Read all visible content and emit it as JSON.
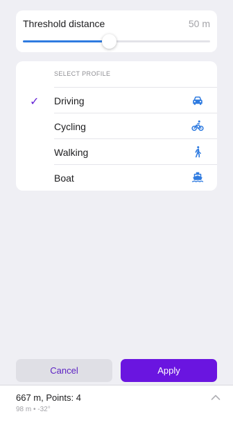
{
  "threshold": {
    "label": "Threshold distance",
    "value_text": "50 m",
    "slider_fraction": 0.46
  },
  "profile": {
    "header": "SELECT PROFILE",
    "selected": "Driving",
    "items": [
      {
        "label": "Driving",
        "icon": "car-icon",
        "selected": true
      },
      {
        "label": "Cycling",
        "icon": "bicycle-icon",
        "selected": false
      },
      {
        "label": "Walking",
        "icon": "walking-icon",
        "selected": false
      },
      {
        "label": "Boat",
        "icon": "boat-icon",
        "selected": false
      }
    ],
    "check_glyph": "✓"
  },
  "actions": {
    "cancel_label": "Cancel",
    "apply_label": "Apply"
  },
  "summary": {
    "title": "667 m, Points: 4",
    "subtitle": "98 m • -32°"
  },
  "colors": {
    "accent": "#6a15e0",
    "icon_blue": "#2f7be0",
    "slider_blue": "#2f7be0"
  }
}
